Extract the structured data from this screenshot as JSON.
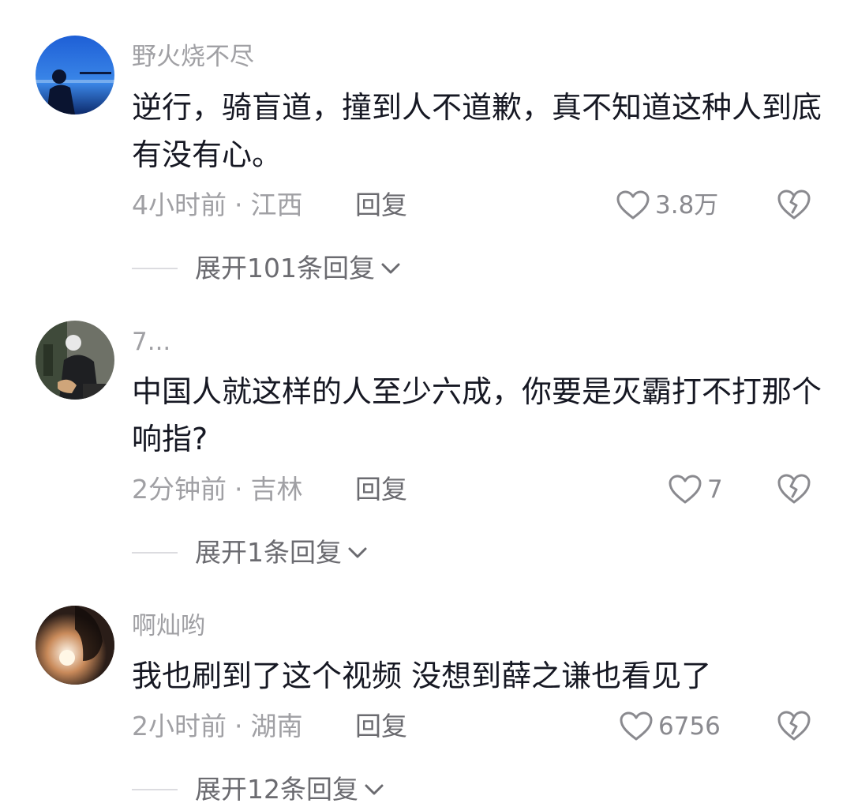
{
  "comments": [
    {
      "username": "野火烧不尽",
      "content": "逆行，骑盲道，撞到人不道歉，真不知道这种人到底有没有心。",
      "time": "4小时前",
      "location": "江西",
      "reply_label": "回复",
      "likes": "3.8万",
      "expand_label": "展开101条回复"
    },
    {
      "username": "7...",
      "content": "中国人就这样的人至少六成，你要是灭霸打不打那个响指?",
      "time": "2分钟前",
      "location": "吉林",
      "reply_label": "回复",
      "likes": "7",
      "expand_label": "展开1条回复"
    },
    {
      "username": "啊灿哟",
      "content": "我也刷到了这个视频 没想到薛之谦也看见了",
      "time": "2小时前",
      "location": "湖南",
      "reply_label": "回复",
      "likes": "6756",
      "expand_label": "展开12条回复"
    }
  ],
  "separator": "·",
  "colors": {
    "text_primary": "#161823",
    "text_secondary": "#a0a0a4",
    "icon": "#8a8a8f"
  },
  "icons": {
    "like": "heart-outline-icon",
    "dislike": "broken-heart-icon",
    "expand": "chevron-down-icon"
  }
}
